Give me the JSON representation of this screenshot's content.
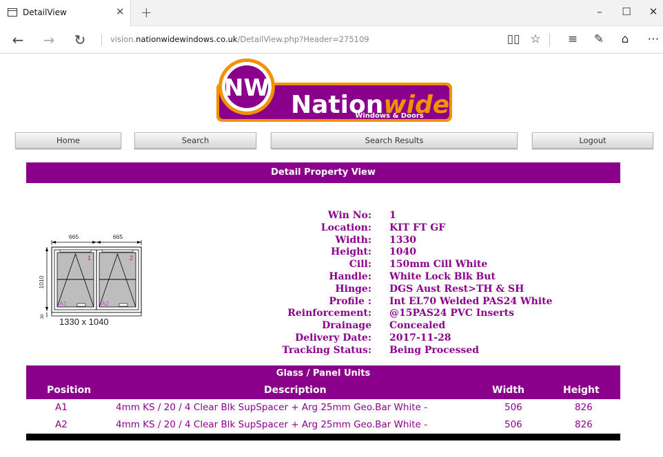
{
  "browser": {
    "tab_title": "DetailView",
    "url_prefix": "vision.",
    "url_domain": "nationwidewindows.co.uk",
    "url_path": "/DetailView.php?Header=275109"
  },
  "logo": {
    "initials": "NW",
    "name_main": "Nation",
    "name_accent": "wide",
    "tagline": "Windows & Doors"
  },
  "menu": {
    "home": "Home",
    "search": "Search",
    "search_results": "Search Results",
    "logout": "Logout"
  },
  "detail_title": "Detail Property View",
  "details": [
    {
      "label": "Win No:",
      "value": "1"
    },
    {
      "label": "Location:",
      "value": "KIT FT GF"
    },
    {
      "label": "Width:",
      "value": "1330"
    },
    {
      "label": "Height:",
      "value": "1040"
    },
    {
      "label": "Cill:",
      "value": "150mm Cill White"
    },
    {
      "label": "Handle:",
      "value": "White Lock Blk But"
    },
    {
      "label": "Hinge:",
      "value": "DGS Aust Rest>TH & SH"
    },
    {
      "label": "Profile :",
      "value": "Int EL70 Welded PAS24 White"
    },
    {
      "label": "Reinforcement:",
      "value": "@15PAS24 PVC Inserts"
    },
    {
      "label": "Drainage",
      "value": "Concealed"
    },
    {
      "label": "Delivery Date:",
      "value": "2017-11-28"
    },
    {
      "label": "Tracking Status:",
      "value": "Being Processed"
    }
  ],
  "diagram": {
    "left_width": "665",
    "right_width": "665",
    "height_label": "1010",
    "cill_label": "30",
    "pane1": "1",
    "pane2": "2",
    "glass1": "A1",
    "glass2": "A2",
    "caption": "1330 x 1040"
  },
  "glass": {
    "title": "Glass / Panel Units",
    "headers": {
      "position": "Position",
      "description": "Description",
      "width": "Width",
      "height": "Height"
    },
    "rows": [
      {
        "position": "A1",
        "description": "4mm KS / 20 / 4 Clear Blk SupSpacer + Arg 25mm Geo.Bar White -",
        "width": "506",
        "height": "826"
      },
      {
        "position": "A2",
        "description": "4mm KS / 20 / 4 Clear Blk SupSpacer + Arg 25mm Geo.Bar White -",
        "width": "506",
        "height": "826"
      }
    ]
  },
  "colors": {
    "brand_purple": "#8b008b",
    "logo_orange": "#f39200"
  }
}
